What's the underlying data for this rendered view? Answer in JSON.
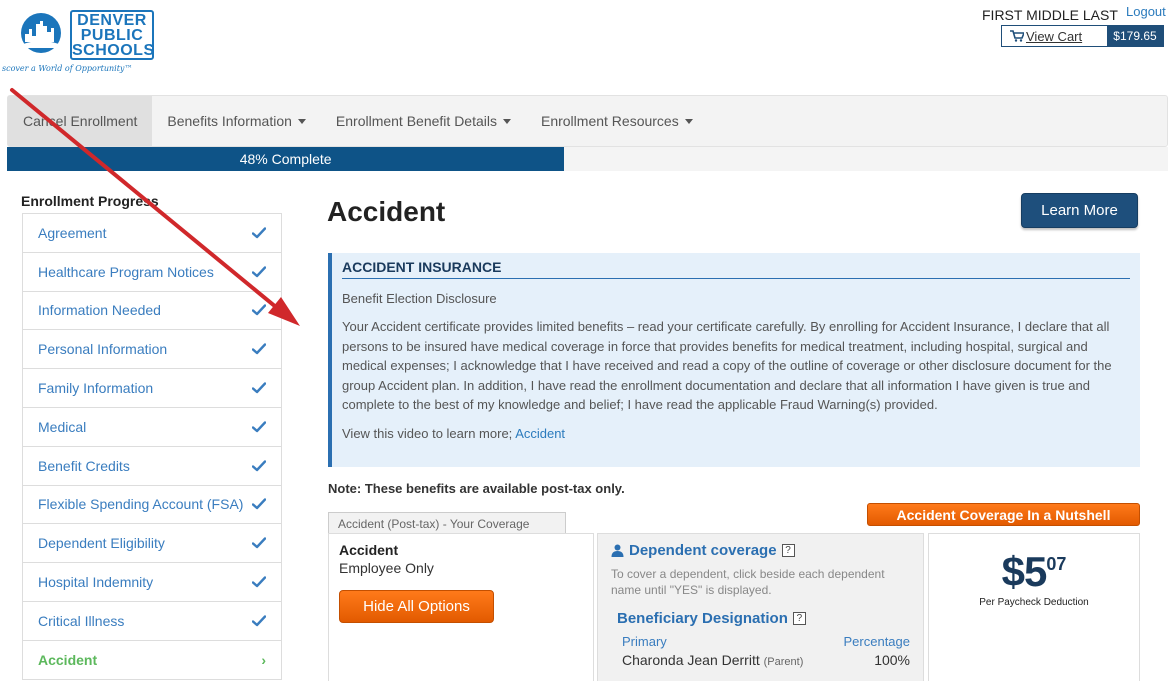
{
  "header": {
    "logo_lines": [
      "DENVER",
      "PUBLIC",
      "SCHOOLS"
    ],
    "logo_tagline": "scover a World of Opportunity™",
    "user_name": "FIRST MIDDLE LAST",
    "logout": "Logout",
    "cart_label": "View Cart",
    "cart_total": "$179.65"
  },
  "nav": {
    "items": [
      {
        "label": "Cancel Enrollment"
      },
      {
        "label": "Benefits Information"
      },
      {
        "label": "Enrollment Benefit Details"
      },
      {
        "label": "Enrollment Resources"
      }
    ]
  },
  "progress": {
    "label": "48% Complete",
    "percent": 48
  },
  "sidebar": {
    "title": "Enrollment Progress",
    "items": [
      {
        "label": "Agreement",
        "status": "complete"
      },
      {
        "label": "Healthcare Program Notices",
        "status": "complete"
      },
      {
        "label": "Information Needed",
        "status": "complete"
      },
      {
        "label": "Personal Information",
        "status": "complete"
      },
      {
        "label": "Family Information",
        "status": "complete"
      },
      {
        "label": "Medical",
        "status": "complete"
      },
      {
        "label": "Benefit Credits",
        "status": "complete"
      },
      {
        "label": "Flexible Spending Account (FSA)",
        "status": "complete"
      },
      {
        "label": "Dependent Eligibility",
        "status": "complete"
      },
      {
        "label": "Hospital Indemnity",
        "status": "complete"
      },
      {
        "label": "Critical Illness",
        "status": "complete"
      },
      {
        "label": "Accident",
        "status": "current"
      }
    ]
  },
  "main": {
    "title": "Accident",
    "learn_more": "Learn More",
    "disclosure": {
      "heading": "ACCIDENT INSURANCE",
      "subheading": "Benefit Election Disclosure",
      "body": "Your Accident certificate provides limited benefits – read your certificate carefully. By enrolling for Accident Insurance, I declare that all persons to be insured have medical coverage in force that provides benefits for medical treatment, including hospital, surgical and medical expenses; I acknowledge that I have received and read a copy of the outline of coverage or other disclosure document for the group Accident plan. In addition, I have read the enrollment documentation and declare that all information I have given is true and complete to the best of my knowledge and belief; I have read the applicable Fraud Warning(s) provided.",
      "video_prefix": "View this video to learn more; ",
      "video_link": "Accident"
    },
    "note": "Note: These benefits are available post-tax only.",
    "nutshell_button": "Accident Coverage In a Nutshell",
    "coverage_tab": "Accident (Post-tax) - Your Coverage",
    "coverage": {
      "plan": "Accident",
      "tier": "Employee Only",
      "hide_button": "Hide All Options"
    },
    "dependent": {
      "heading": "Dependent coverage",
      "help": "?",
      "text": "To cover a dependent, click beside each dependent name until \"YES\" is displayed."
    },
    "beneficiary": {
      "heading": "Beneficiary Designation",
      "help": "?",
      "col_type": "Primary",
      "col_pct": "Percentage",
      "name": "Charonda Jean Derritt",
      "relation": "(Parent)",
      "percent": "100%"
    },
    "price": {
      "dollars": "$5",
      "cents": "07",
      "label": "Per Paycheck Deduction"
    }
  },
  "colors": {
    "brand_blue": "#1b75bb",
    "progress": "#0e5387",
    "orange": "#f26a0a",
    "complete_green": "#5cb85c",
    "annotation_arrow": "#d0282b"
  }
}
